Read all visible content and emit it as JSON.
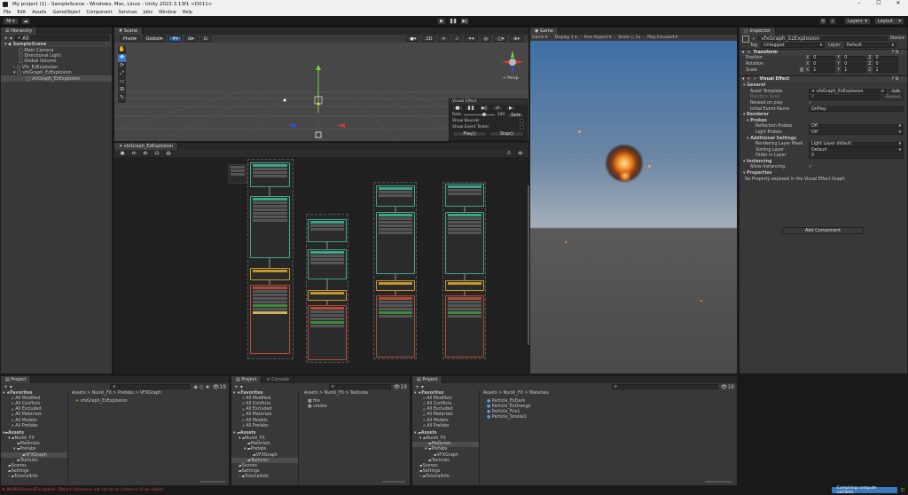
{
  "window": {
    "title": "My project (1) - SampleScene - Windows, Mac, Linux - Unity 2022.3.13f1 <DX11>"
  },
  "menu": [
    "File",
    "Edit",
    "Assets",
    "GameObject",
    "Component",
    "Services",
    "Jobs",
    "Window",
    "Help"
  ],
  "toolbar": {
    "account": "NI",
    "layers": "Layers",
    "layout": "Layout"
  },
  "hierarchy": {
    "tab": "Hierarchy",
    "search": "All",
    "scene": "SampleScene",
    "items": [
      {
        "label": "Main Camera",
        "level": 2
      },
      {
        "label": "Directional Light",
        "level": 2
      },
      {
        "label": "Global Volume",
        "level": 2
      },
      {
        "label": "Vfx_EzExplosion",
        "level": 2
      },
      {
        "label": "vfxGraph_EzExplosion",
        "level": 2
      },
      {
        "label": "vfxGraph_EzExplosion",
        "level": 3
      }
    ]
  },
  "scene_view": {
    "tab": "Scene",
    "pivot": "Pivot",
    "global": "Global",
    "grid_size": "2D",
    "persp": "< Persp",
    "visual_effect": {
      "title": "Visual Effect",
      "rate_label": "Rate",
      "rate_value": "100",
      "set": "Set",
      "show_bounds": "Show Bounds",
      "show_event_tester": "Show Event Tester",
      "play": "Play()",
      "stop": "Stop()"
    }
  },
  "vfx_graph": {
    "tab": "vfxGraph_EzExplosion"
  },
  "game_view": {
    "tab": "Game",
    "mode": "Game",
    "display": "Display 1",
    "aspect": "Free Aspect",
    "scale_label": "Scale",
    "scale_value": "1x",
    "play_focused": "Play Focused"
  },
  "inspector": {
    "tab": "Inspector",
    "object_name": "vfxGraph_EzExplosion",
    "static": "Static",
    "tag_label": "Tag",
    "tag_value": "Untagged",
    "layer_label": "Layer",
    "layer_value": "Default",
    "transform": {
      "title": "Transform",
      "position": {
        "label": "Position",
        "x": "0",
        "y": "0",
        "z": "0"
      },
      "rotation": {
        "label": "Rotation",
        "x": "0",
        "y": "0",
        "z": "0"
      },
      "scale": {
        "label": "Scale",
        "x": "1",
        "y": "1",
        "z": "1"
      }
    },
    "visual_effect": {
      "title": "Visual Effect",
      "general": "General",
      "asset_template_label": "Asset Template",
      "asset_template_value": "vfxGraph_EzExplosion",
      "edit": "Edit",
      "random_seed_label": "Random Seed",
      "random_seed_value": "0",
      "reseed_button": "Reseed",
      "reseed_on_play": "Reseed on play",
      "initial_event_label": "Initial Event Name",
      "initial_event_value": "OnPlay",
      "renderer": "Renderer",
      "probes": "Probes",
      "reflection_probes_label": "Reflection Probes",
      "reflection_probes_value": "Off",
      "light_probes_label": "Light Probes",
      "light_probes_value": "Off",
      "additional_settings": "Additional Settings",
      "rendering_layer_mask_label": "Rendering Layer Mask",
      "rendering_layer_mask_value": "Light Layer default",
      "sorting_layer_label": "Sorting Layer",
      "sorting_layer_value": "Default",
      "order_in_layer_label": "Order in Layer",
      "order_in_layer_value": "0",
      "instancing": "Instancing",
      "allow_instancing": "Allow Instancing",
      "properties": "Properties",
      "no_property": "No Property exposed in the Visual Effect Graph"
    },
    "add_component": "Add Component"
  },
  "project1": {
    "tab": "Project",
    "breadcrumb": "Assets > Nunki_FX > Prefabs > VFXGraph",
    "count": "19",
    "files": [
      "vfxGraph_EzExplosion"
    ]
  },
  "project2": {
    "tab": "Project",
    "tab2": "Console",
    "breadcrumb": "Assets > Nunki_FX > Textures",
    "count": "19",
    "files": [
      "fire",
      "smoke"
    ]
  },
  "project3": {
    "tab": "Project",
    "breadcrumb": "Assets > Nunki_FX > Materials",
    "count": "19",
    "files": [
      "Particle_ExDark",
      "Particle_ExOrange",
      "Particle_Fire1",
      "Particle_Smoke1"
    ]
  },
  "tree": {
    "favorites": "Favorites",
    "fav_items": [
      "All Modified",
      "All Conflicts",
      "All Excluded",
      "All Materials",
      "All Models",
      "All Prefabs"
    ],
    "assets": "Assets",
    "asset_items": [
      {
        "label": "Nunki_FX",
        "level": 1
      },
      {
        "label": "Materials",
        "level": 2
      },
      {
        "label": "Prefabs",
        "level": 2
      },
      {
        "label": "VFXGraph",
        "level": 3
      },
      {
        "label": "Textures",
        "level": 2
      },
      {
        "label": "Scenes",
        "level": 1
      },
      {
        "label": "Settings",
        "level": 1
      },
      {
        "label": "TutorialInfo",
        "level": 1
      }
    ]
  },
  "status": {
    "error": "NullReferenceException: Object reference not set to an instance of an object",
    "right": "Compiling compute variants"
  },
  "colors": {
    "accent": "#3a79bb",
    "error": "#d04040",
    "node_green": "#3fa389",
    "node_orange": "#c2962c",
    "node_red": "#b04a37"
  }
}
